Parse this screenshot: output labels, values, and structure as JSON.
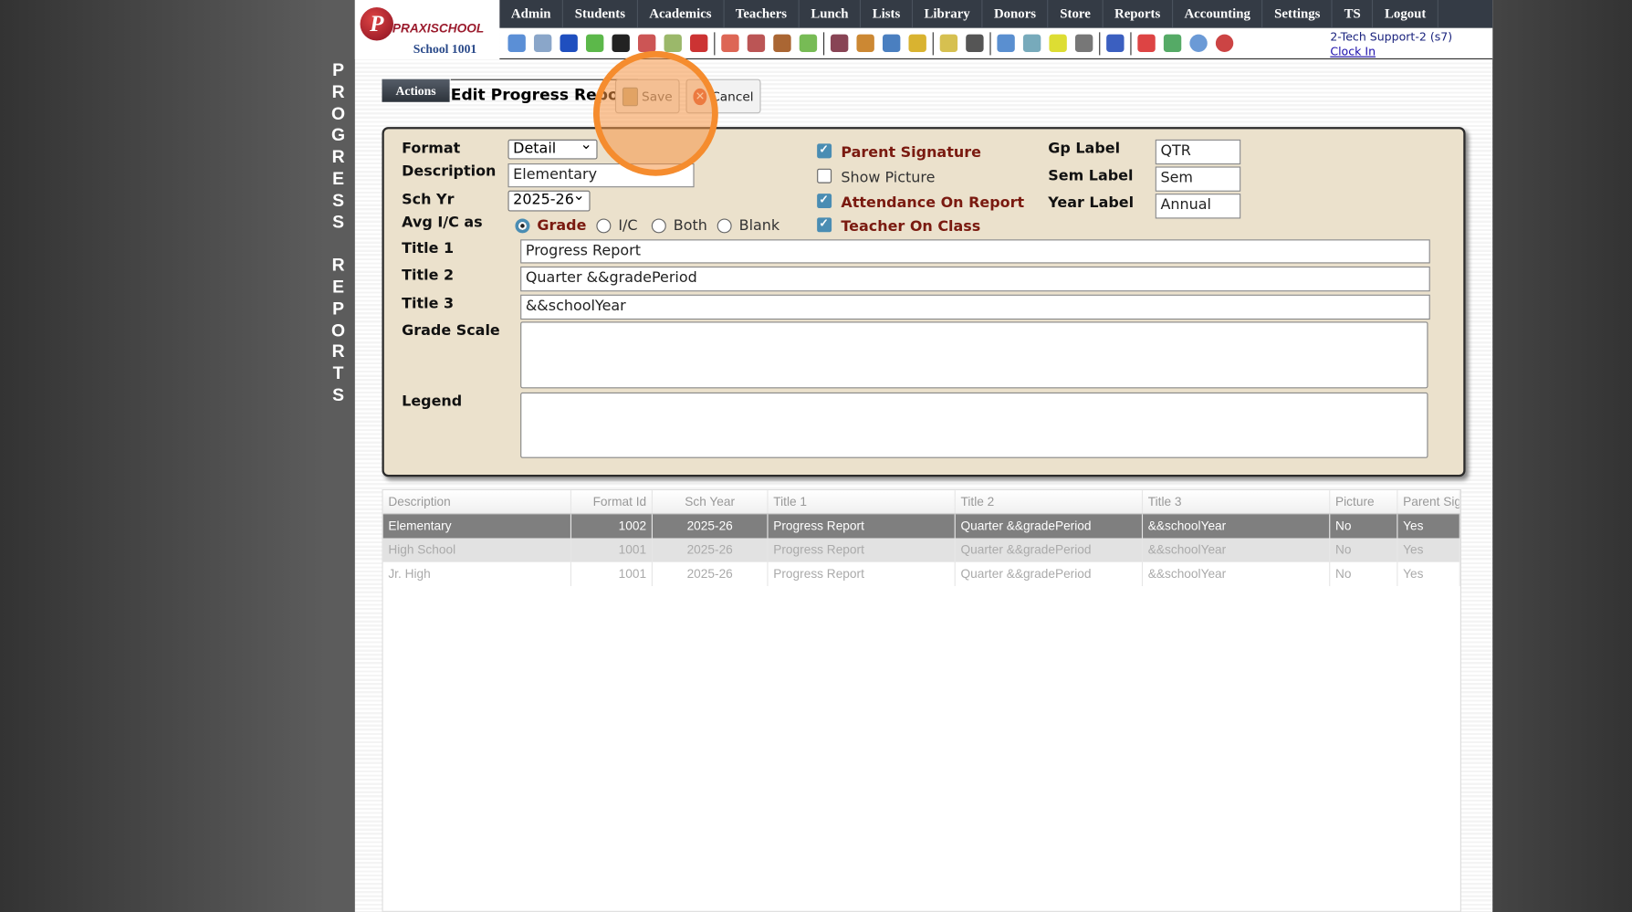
{
  "side_title": "PROGRESS REPORTS",
  "logo": {
    "brand": "PRAXISCHOOL",
    "school": "School 1001"
  },
  "nav": [
    "Admin",
    "Students",
    "Academics",
    "Teachers",
    "Lunch",
    "Lists",
    "Library",
    "Donors",
    "Store",
    "Reports",
    "Accounting",
    "Settings",
    "TS",
    "Logout"
  ],
  "toolbar_icons": [
    "search-icon",
    "calendar-grid-icon",
    "email-at-icon",
    "chat-icon",
    "phone-icon",
    "speaker-icon",
    "schedule-icon",
    "calendar-icon",
    "megaphone-icon",
    "add-student-icon",
    "student-icon",
    "money-icon",
    "parents-icon",
    "lunch-icon",
    "book-icon",
    "bell-icon",
    "export-icon",
    "teacher-icon",
    "alarm-clock-icon",
    "report-icon",
    "card-icon",
    "printer-icon",
    "ap-icon",
    "pdf-icon",
    "cash-register-icon",
    "help-icon",
    "alert-icon"
  ],
  "user": {
    "name": "2-Tech Support-2 (s7)",
    "clock_in": "Clock In"
  },
  "actions_label": "Actions",
  "page_title": "Edit Progress Report",
  "save_label": "Save",
  "cancel_label": "Cancel",
  "colors": {
    "nav_bg": "#343b45",
    "form_bg": "#ebe1cc",
    "highlight": "#f58c2e",
    "checked_label": "#7a1a10"
  },
  "form": {
    "format_label": "Format",
    "format_value": "Detail",
    "description_label": "Description",
    "description_value": "Elementary",
    "sch_yr_label": "Sch Yr",
    "sch_yr_value": "2025-26",
    "avg_label": "Avg I/C as",
    "avg_options": [
      {
        "label": "Grade",
        "checked": true
      },
      {
        "label": "I/C",
        "checked": false
      },
      {
        "label": "Both",
        "checked": false
      },
      {
        "label": "Blank",
        "checked": false
      }
    ],
    "checkboxes": [
      {
        "label": "Parent Signature",
        "checked": true
      },
      {
        "label": "Show Picture",
        "checked": false
      },
      {
        "label": "Attendance On Report",
        "checked": true
      },
      {
        "label": "Teacher On Class",
        "checked": true
      }
    ],
    "gp_label": "Gp Label",
    "gp_value": "QTR",
    "sem_label": "Sem Label",
    "sem_value": "Sem",
    "year_label": "Year Label",
    "year_value": "Annual",
    "title1_label": "Title 1",
    "title1_value": "Progress Report",
    "title2_label": "Title 2",
    "title2_value": "Quarter &&gradePeriod",
    "title3_label": "Title 3",
    "title3_value": "&&schoolYear",
    "grade_scale_label": "Grade Scale",
    "grade_scale_value": "",
    "legend_label": "Legend",
    "legend_value": ""
  },
  "table": {
    "columns": [
      "Description",
      "Format Id",
      "Sch Year",
      "Title 1",
      "Title 2",
      "Title 3",
      "Picture",
      "Parent Sig"
    ],
    "rows": [
      [
        "Elementary",
        "1002",
        "2025-26",
        "Progress Report",
        "Quarter &&gradePeriod",
        "&&schoolYear",
        "No",
        "Yes"
      ],
      [
        "High School",
        "1001",
        "2025-26",
        "Progress Report",
        "Quarter &&gradePeriod",
        "&&schoolYear",
        "No",
        "Yes"
      ],
      [
        "Jr. High",
        "1001",
        "2025-26",
        "Progress Report",
        "Quarter &&gradePeriod",
        "&&schoolYear",
        "No",
        "Yes"
      ]
    ]
  }
}
